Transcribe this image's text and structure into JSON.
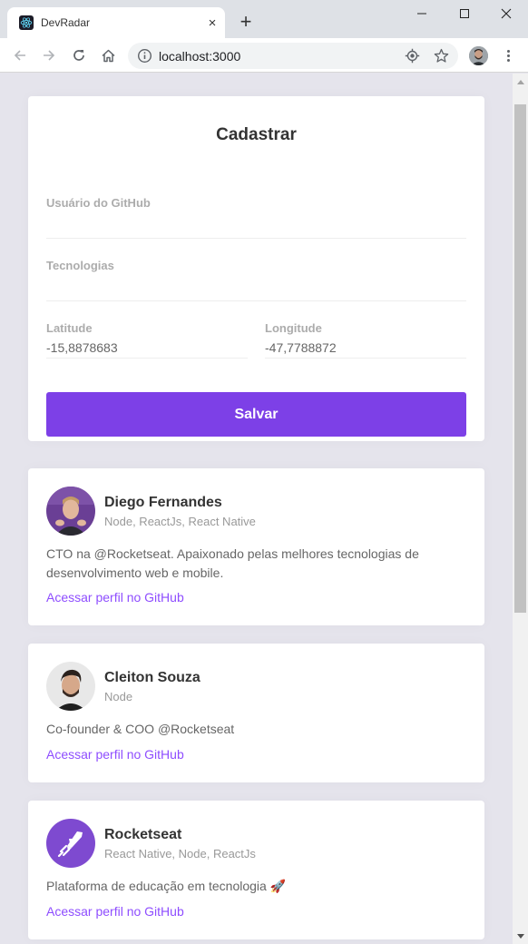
{
  "browser": {
    "tab_title": "DevRadar",
    "tab_close": "×",
    "new_tab": "+",
    "url": "localhost:3000"
  },
  "form": {
    "title": "Cadastrar",
    "github_user_label": "Usuário do GitHub",
    "github_user_value": "",
    "techs_label": "Tecnologias",
    "techs_value": "",
    "latitude_label": "Latitude",
    "latitude_value": "-15,8878683",
    "longitude_label": "Longitude",
    "longitude_value": "-47,7788872",
    "save_label": "Salvar"
  },
  "devs": [
    {
      "name": "Diego Fernandes",
      "techs": "Node, ReactJs, React Native",
      "bio": "CTO na @Rocketseat. Apaixonado pelas melhores tecnologias de desenvolvimento web e mobile.",
      "link": "Acessar perfil no GitHub"
    },
    {
      "name": "Cleiton Souza",
      "techs": "Node",
      "bio": "Co-founder & COO @Rocketseat",
      "link": "Acessar perfil no GitHub"
    },
    {
      "name": "Rocketseat",
      "techs": "React Native, Node, ReactJs",
      "bio": "Plataforma de educação em tecnologia 🚀",
      "link": "Acessar perfil no GitHub"
    }
  ],
  "colors": {
    "page_background": "#e5e4ec",
    "accent": "#7d40e7",
    "link": "#8e4dff",
    "card": "#ffffff"
  },
  "icons": {
    "tab_favicon": "react-atom-icon",
    "back": "arrow-left-icon",
    "forward": "arrow-right-icon",
    "reload": "reload-icon",
    "home": "home-icon",
    "site_info": "info-circle-icon",
    "location": "location-target-icon",
    "bookmark": "star-icon",
    "menu": "three-dots-icon"
  }
}
